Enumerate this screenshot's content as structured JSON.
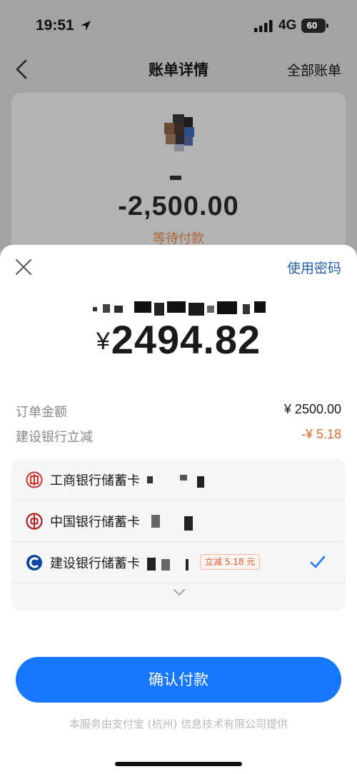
{
  "status_bar": {
    "time": "19:51",
    "network": "4G",
    "battery": "60",
    "location_icon": "location-arrow-icon",
    "signal_icon": "signal-bars-icon"
  },
  "nav": {
    "back_icon": "chevron-left-icon",
    "title": "账单详情",
    "all_bills": "全部账单"
  },
  "bill": {
    "amount": "-2,500.00",
    "status": "等待付款",
    "status_color": "#b0673a"
  },
  "payment": {
    "close_icon": "close-icon",
    "use_password": "使用密码",
    "currency": "¥",
    "amount": "2494.82",
    "order_label": "订单金额",
    "order_value": "¥ 2500.00",
    "discount_label": "建设银行立减",
    "discount_value": "-¥ 5.18",
    "discount_color": "#e06a2c",
    "cards": [
      {
        "name": "工商银行储蓄卡",
        "icon": "icbc-logo-icon",
        "selected": false
      },
      {
        "name": "中国银行储蓄卡",
        "icon": "boc-logo-icon",
        "selected": false
      },
      {
        "name": "建设银行储蓄卡",
        "icon": "ccb-logo-icon",
        "badge": "立减 5.18 元",
        "selected": true
      }
    ],
    "expand_icon": "chevron-down-icon",
    "confirm_button": "确认付款",
    "accent_color": "#1677ff",
    "footer": "本服务由支付宝 (杭州) 信息技术有限公司提供"
  }
}
